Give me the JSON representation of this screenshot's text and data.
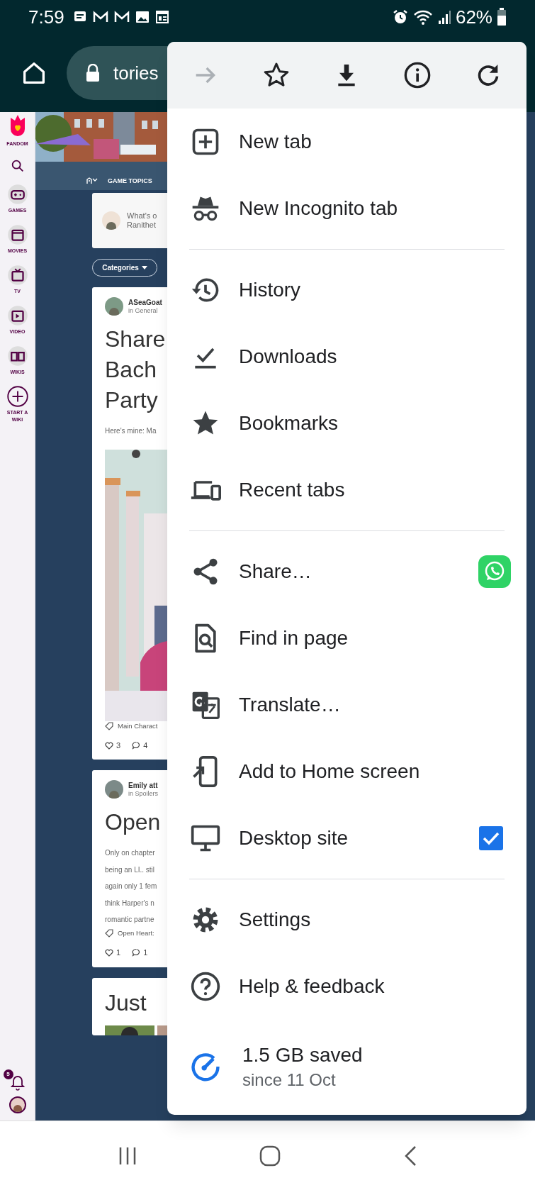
{
  "status_bar": {
    "time": "7:59",
    "battery": "62%"
  },
  "toolbar": {
    "url": "tories"
  },
  "sidebar": {
    "logo_label": "FANDOM",
    "items": [
      {
        "kind": "search"
      },
      {
        "kind": "games",
        "label": "GAMES"
      },
      {
        "kind": "movies",
        "label": "MOVIES"
      },
      {
        "kind": "tv",
        "label": "TV"
      },
      {
        "kind": "video",
        "label": "VIDEO"
      },
      {
        "kind": "wikis",
        "label": "WIKIS"
      },
      {
        "kind": "start",
        "label": "START A WIKI"
      }
    ],
    "notification_count": "5"
  },
  "feed": {
    "nav_label": "GAME TOPICS",
    "composer_lines": [
      "What's o",
      "Ranithet"
    ],
    "filter": "Categories",
    "posts": [
      {
        "author": "ASeaGoat",
        "category": "in General",
        "title_lines": [
          "Share",
          "Bach",
          "Party"
        ],
        "excerpt_lines": [
          "Here's mine: Ma"
        ],
        "media": {
          "kind": "picture"
        },
        "tag": "Main Charact",
        "likes": "3",
        "comments": "4"
      },
      {
        "author": "Emily att",
        "category": "in Spoilers",
        "title_lines": [
          "Open"
        ],
        "excerpt_lines": [
          "Only on chapter",
          "being an LI.. stil",
          "again only 1 fem",
          "think Harper's n",
          "romantic partne"
        ],
        "tag": "Open Heart:",
        "likes": "1",
        "comments": "1"
      },
      {
        "title_lines": [
          "Just"
        ],
        "media": {
          "kind": "picture"
        }
      }
    ]
  },
  "menu": {
    "top_actions": [
      {
        "kind": "forward",
        "disabled": true
      },
      {
        "kind": "bookmark",
        "disabled": false
      },
      {
        "kind": "download",
        "disabled": false
      },
      {
        "kind": "info",
        "disabled": false
      },
      {
        "kind": "refresh",
        "disabled": false
      }
    ],
    "groups": [
      {
        "items": [
          {
            "kind": "new-tab",
            "label": "New tab"
          },
          {
            "kind": "incognito",
            "label": "New Incognito tab"
          }
        ]
      },
      {
        "items": [
          {
            "kind": "history",
            "label": "History"
          },
          {
            "kind": "downloads",
            "label": "Downloads"
          },
          {
            "kind": "bookmarks",
            "label": "Bookmarks"
          },
          {
            "kind": "recent-tabs",
            "label": "Recent tabs"
          }
        ]
      },
      {
        "items": [
          {
            "kind": "share",
            "label": "Share…"
          },
          {
            "kind": "find",
            "label": "Find in page"
          },
          {
            "kind": "translate",
            "label": "Translate…"
          },
          {
            "kind": "add-home",
            "label": "Add to Home screen"
          },
          {
            "kind": "desktop",
            "label": "Desktop site",
            "checked": true
          }
        ]
      },
      {
        "items": [
          {
            "kind": "settings",
            "label": "Settings"
          },
          {
            "kind": "help",
            "label": "Help & feedback"
          },
          {
            "kind": "saver",
            "label": "1.5 GB saved",
            "sublabel": "since 11 Oct"
          }
        ]
      }
    ]
  }
}
